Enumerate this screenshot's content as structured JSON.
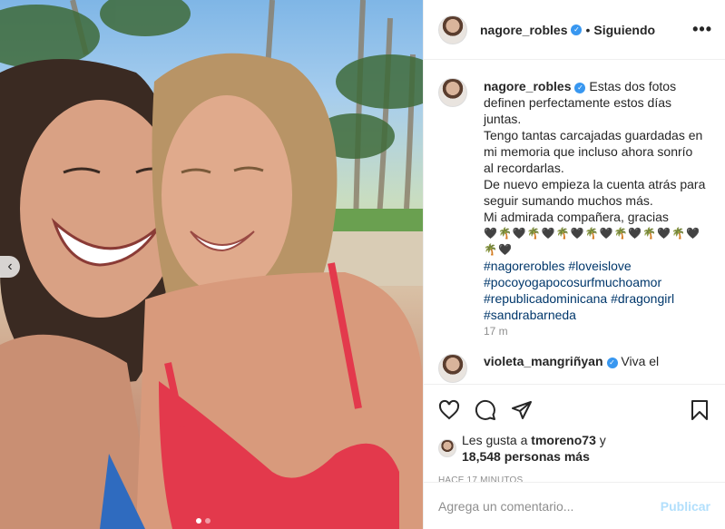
{
  "post": {
    "username": "nagore_robles",
    "follow_label": "Siguiendo",
    "separator": "•",
    "more_icon": "more-icon"
  },
  "caption": {
    "username": "nagore_robles",
    "lines": [
      "Estas dos fotos definen perfectamente estos días juntas.",
      "Tengo tantas carcajadas guardadas en mi memoria que incluso ahora sonrío al recordarlas.",
      "De nuevo empieza la cuenta atrás para seguir sumando muchos más.",
      "Mi admirada compañera, gracias"
    ],
    "emoji_line": "🖤🌴🖤🌴🖤🌴🖤🌴🖤🌴🖤🌴🖤🌴🖤🌴🖤",
    "hashtags": [
      "#nagorerobles",
      "#loveislove",
      "#pocoyogapocosurfmuchoamor",
      "#republicadominicana",
      "#dragongirl",
      "#sandrabarneda"
    ],
    "time": "17 m"
  },
  "next_comment": {
    "username": "violeta_mangriñyan",
    "text": "Viva el"
  },
  "likes": {
    "prefix": "Les gusta a",
    "user": "tmoreno73",
    "conjunction": "y",
    "count": "18,548 personas más"
  },
  "timestamp": "HACE 17 MINUTOS",
  "comment_box": {
    "placeholder": "Agrega un comentario...",
    "publish_label": "Publicar"
  },
  "carousel": {
    "total": 2,
    "current": 1,
    "prev_icon": "chevron-left-icon"
  },
  "colors": {
    "link": "#00376b",
    "verified": "#3897f0",
    "muted": "#8e8e8e",
    "publish_disabled": "#b2dffc"
  }
}
